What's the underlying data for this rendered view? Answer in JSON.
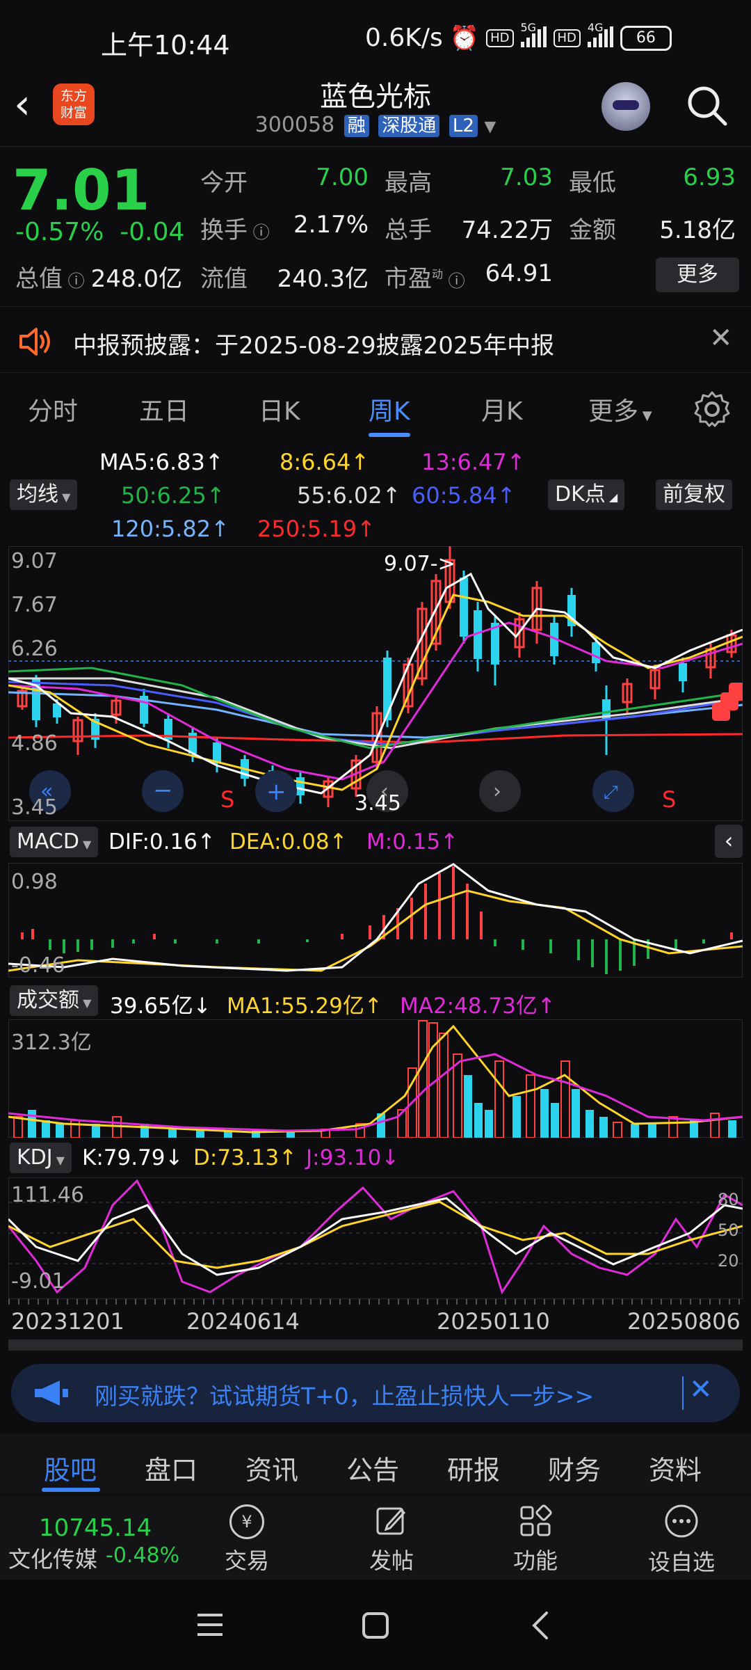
{
  "status_bar": {
    "time": "上午10:44",
    "net_speed": "0.6K/s",
    "battery": "66",
    "net_5g": "5G",
    "net_4g": "4G",
    "hd": "HD"
  },
  "header": {
    "logo_text_1": "东方",
    "logo_text_2": "财富",
    "stock_name": "蓝色光标",
    "stock_code": "300058",
    "tags": [
      "融",
      "深股通",
      "L2"
    ]
  },
  "quote": {
    "price": "7.01",
    "change_pct": "-0.57%",
    "change_amt": "-0.04",
    "open_label": "今开",
    "open": "7.00",
    "high_label": "最高",
    "high": "7.03",
    "low_label": "最低",
    "low": "6.93",
    "turnover_label": "换手",
    "turnover": "2.17%",
    "volume_label": "总手",
    "volume": "74.22万",
    "amount_label": "金额",
    "amount": "5.18亿",
    "total_mv_label": "总值",
    "total_mv": "248.0亿",
    "float_mv_label": "流值",
    "float_mv": "240.3亿",
    "pe_label": "市盈",
    "pe_sup": "动",
    "pe": "64.91",
    "more_label": "更多"
  },
  "notice": {
    "text": "中报预披露：于2025-08-29披露2025年中报"
  },
  "tabs": [
    "分时",
    "五日",
    "日K",
    "周K",
    "月K",
    "更多"
  ],
  "active_tab": "周K",
  "ma_legend": {
    "ma5": "MA5:6.83↑",
    "ma8": "8:6.64↑",
    "ma13": "13:6.47↑",
    "ma50": "50:6.25↑",
    "ma55": "55:6.02↑",
    "ma60": "60:5.84↑",
    "ma120": "120:5.82↑",
    "ma250": "250:5.19↑",
    "select": "均线",
    "dk": "DK点",
    "adjust": "前复权"
  },
  "kline_axis": {
    "top": "9.07",
    "l2": "7.67",
    "l3": "6.26",
    "l4": "4.86",
    "bottom": "3.45",
    "high_mark": "9.07->",
    "low_mark": "3.45",
    "s_mark": "S"
  },
  "macd": {
    "name": "MACD",
    "dif": "DIF:0.16↑",
    "dea": "DEA:0.08↑",
    "m": "M:0.15↑",
    "top": "0.98",
    "bottom": "-0.46"
  },
  "volume": {
    "name": "成交额",
    "val": "39.65亿↓",
    "ma1": "MA1:55.29亿↑",
    "ma2": "MA2:48.73亿↑",
    "top": "312.3亿"
  },
  "kdj": {
    "name": "KDJ",
    "k": "K:79.79↓",
    "d": "D:73.13↑",
    "j": "J:93.10↓",
    "top": "111.46",
    "bottom": "-9.01",
    "r80": "80",
    "r50": "50",
    "r20": "20"
  },
  "dates": [
    "20231201",
    "20240614",
    "20250110",
    "20250806"
  ],
  "banner": {
    "text": "刚买就跌？试试期货T+0，止盈止损快人一步>>"
  },
  "bottom_tabs": [
    "股吧",
    "盘口",
    "资讯",
    "公告",
    "研报",
    "财务",
    "资料"
  ],
  "footer": {
    "index_value": "10745.14",
    "index_name": "文化传媒",
    "index_change": "-0.48%",
    "trade": "交易",
    "post": "发帖",
    "func": "功能",
    "watch": "设自选"
  },
  "chart_data": {
    "type": "line",
    "title": "",
    "x": [
      "20231201",
      "20240614",
      "20250110",
      "20250806"
    ],
    "y_range": [
      3.45,
      9.07
    ],
    "series": [
      {
        "name": "MA5",
        "value": 6.83
      },
      {
        "name": "8",
        "value": 6.64
      },
      {
        "name": "13",
        "value": 6.47
      },
      {
        "name": "50",
        "value": 6.25
      },
      {
        "name": "55",
        "value": 6.02
      },
      {
        "name": "60",
        "value": 5.84
      },
      {
        "name": "120",
        "value": 5.82
      },
      {
        "name": "250",
        "value": 5.19
      }
    ]
  }
}
